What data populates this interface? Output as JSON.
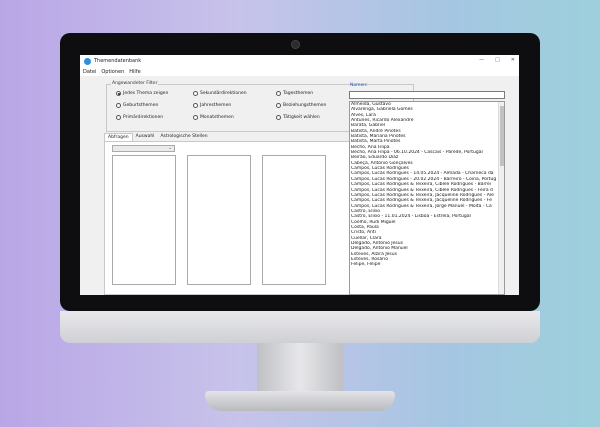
{
  "window": {
    "title": "Themendatenbank"
  },
  "menu": [
    "Datei",
    "Optionen",
    "Hilfe"
  ],
  "filter": {
    "legend": "Angewandeter Filter",
    "options": [
      {
        "label": "Jedes Thema zeigen",
        "selected": true
      },
      {
        "label": "Sekundärdirektionen",
        "selected": false
      },
      {
        "label": "Tagesthemen",
        "selected": false
      },
      {
        "label": "Geburtsthemen",
        "selected": false
      },
      {
        "label": "Jahresthemen",
        "selected": false
      },
      {
        "label": "Beziehungsthemen",
        "selected": false
      },
      {
        "label": "Primärdirektionen",
        "selected": false
      },
      {
        "label": "Monatsthemen",
        "selected": false
      },
      {
        "label": "Tätigkeit wählen",
        "selected": false
      }
    ]
  },
  "tabs": [
    "Abfragen",
    "Auswahl",
    "Astrologische Stellen"
  ],
  "names": {
    "label": "Namen:",
    "items": [
      "Almeida, Gustavo",
      "Alvarenga, Gabriela Gomes",
      "Alves, Lara",
      "Antunes, Ricardo Alexandre",
      "Barata, Gabriel",
      "Batista, André Pinotes",
      "Batista, Mariana Pinotes",
      "Batista, Marta Pinotes",
      "Becho, Ana Filipa",
      "Becho, Ana Filipa - 06.10.2024 - Cascais - Parede, Portugal",
      "Beirão, Eduardo Diaz",
      "Cabeça, António Gonçalves",
      "Campos, Lucas Rodrigues",
      "Campos, Lucas Rodrigues - 14.05.2024 - Almada - Charneca da",
      "Campos, Lucas Rodrigues - 20.02.2024 - Barreiro - Coina, Portug",
      "Campos, Lucas Rodrigues & Teixeira, Cibele Rodrigues - Barrei",
      "Campos, Lucas Rodrigues & Teixeira, Cibele Rodrigues - Feira d",
      "Campos, Lucas Rodrigues & Teixeira, Jacqueline Rodrigues - Ale",
      "Campos, Lucas Rodrigues & Teixeira, Jacqueline Rodrigues - Fe",
      "Campos, Lucas Rodrigues & Teixeira, Jorge Manuel - Moita - Ca",
      "Castro, Elisio",
      "Castro, Elisio - 11.01.2024 - Lisboa - Estrela, Portugal",
      "Coelho, Rudi Miguel",
      "Costa, Paula",
      "Cristo, Anti",
      "Cuellar, Clara",
      "Delgado, António Jesus",
      "Delgado, António Manuel",
      "Esteves, Alzira Jesus",
      "Esteves, Rosário",
      "Felipe, Felipe"
    ]
  }
}
